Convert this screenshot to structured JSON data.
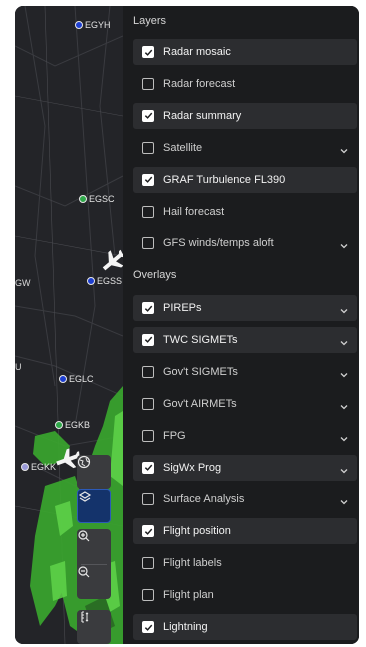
{
  "map": {
    "airports": [
      {
        "code": "EGYH",
        "color": "#1e3fd0"
      },
      {
        "code": "EGSC",
        "color": "#2fa84a"
      },
      {
        "code": "EGSS",
        "color": "#1e3fd0"
      },
      {
        "code": "EGLC",
        "color": "#1e3fd0"
      },
      {
        "code": "EGKB",
        "color": "#2fa84a"
      },
      {
        "code": "EGKK",
        "color": "#9a9ad8"
      }
    ],
    "edge_labels": [
      "GW",
      "U"
    ],
    "controls": [
      {
        "name": "basemap-button",
        "icon": "globe-icon"
      },
      {
        "name": "layers-button",
        "icon": "layers-icon",
        "active": true
      },
      {
        "name": "zoom-in-button",
        "icon": "zoom-in-icon"
      },
      {
        "name": "zoom-out-button",
        "icon": "zoom-out-icon"
      },
      {
        "name": "altitude-button",
        "icon": "altitude-ruler-icon"
      }
    ]
  },
  "panel": {
    "layers_title": "Layers",
    "layers": [
      {
        "label": "Radar mosaic",
        "checked": true,
        "expandable": false
      },
      {
        "label": "Radar forecast",
        "checked": false,
        "expandable": false
      },
      {
        "label": "Radar summary",
        "checked": true,
        "expandable": false
      },
      {
        "label": "Satellite",
        "checked": false,
        "expandable": true
      },
      {
        "label": "GRAF Turbulence FL390",
        "checked": true,
        "expandable": false
      },
      {
        "label": "Hail forecast",
        "checked": false,
        "expandable": false
      },
      {
        "label": "GFS winds/temps aloft",
        "checked": false,
        "expandable": true
      }
    ],
    "overlays_title": "Overlays",
    "overlays": [
      {
        "label": "PIREPs",
        "checked": true,
        "expandable": true
      },
      {
        "label": "TWC SIGMETs",
        "checked": true,
        "expandable": true
      },
      {
        "label": "Gov't SIGMETs",
        "checked": false,
        "expandable": true
      },
      {
        "label": "Gov't AIRMETs",
        "checked": false,
        "expandable": true
      },
      {
        "label": "FPG",
        "checked": false,
        "expandable": true
      },
      {
        "label": "SigWx Prog",
        "checked": true,
        "expandable": true
      },
      {
        "label": "Surface Analysis",
        "checked": false,
        "expandable": true
      },
      {
        "label": "Flight position",
        "checked": true,
        "expandable": false
      },
      {
        "label": "Flight labels",
        "checked": false,
        "expandable": false
      },
      {
        "label": "Flight plan",
        "checked": false,
        "expandable": false
      },
      {
        "label": "Lightning",
        "checked": true,
        "expandable": false
      }
    ]
  }
}
